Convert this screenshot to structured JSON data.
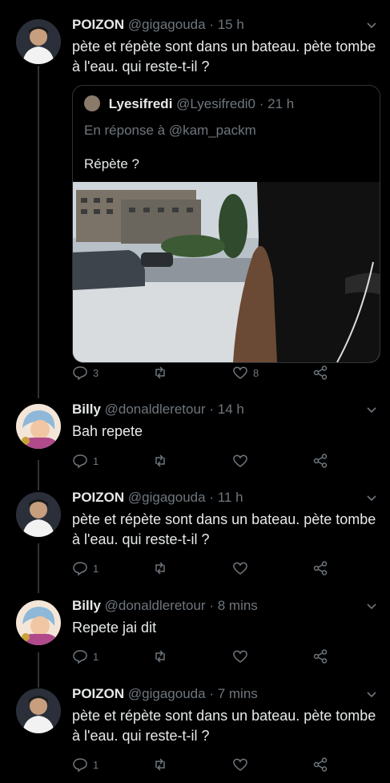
{
  "tweets": [
    {
      "name": "POIZON",
      "handle": "@gigagouda",
      "sep": "·",
      "time": "15 h",
      "text": "pète et répète sont dans un bateau. pète tombe à l'eau. qui reste-t-il ?",
      "replies": "3",
      "retweets": "",
      "likes": "8",
      "avatar_icon": "poizon-avatar",
      "quote": {
        "name": "Lyesifredi",
        "handle": "@Lyesifredi0",
        "sep": "·",
        "time": "21 h",
        "reply_to": "En réponse à @kam_packm",
        "text": "Répète ?"
      }
    },
    {
      "name": "Billy",
      "handle": "@donaldleretour",
      "sep": "·",
      "time": "14 h",
      "text": "Bah repete",
      "replies": "1",
      "retweets": "",
      "likes": "",
      "avatar_icon": "billy-avatar"
    },
    {
      "name": "POIZON",
      "handle": "@gigagouda",
      "sep": "·",
      "time": "11 h",
      "text": "pète et répète sont dans un bateau. pète tombe à l'eau. qui reste-t-il ?",
      "replies": "1",
      "retweets": "",
      "likes": "",
      "avatar_icon": "poizon-avatar"
    },
    {
      "name": "Billy",
      "handle": "@donaldleretour",
      "sep": "·",
      "time": "8 mins",
      "text": "Repete jai dit",
      "replies": "1",
      "retweets": "",
      "likes": "",
      "avatar_icon": "billy-avatar"
    },
    {
      "name": "POIZON",
      "handle": "@gigagouda",
      "sep": "·",
      "time": "7 mins",
      "text": "pète et répète sont dans un bateau. pète tombe à l'eau. qui reste-t-il ?",
      "replies": "1",
      "retweets": "",
      "likes": "",
      "avatar_icon": "poizon-avatar"
    }
  ],
  "colors": {
    "background": "#000000",
    "text": "#e7e9ea",
    "muted": "#6e767d",
    "border": "#2f3336"
  }
}
